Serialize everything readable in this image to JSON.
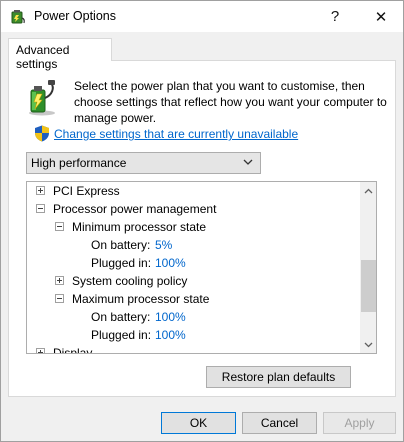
{
  "window": {
    "title": "Power Options",
    "help_label": "?",
    "close_label": "✕"
  },
  "tab": {
    "label": "Advanced settings"
  },
  "intro": {
    "text": "Select the power plan that you want to customise, then choose settings that reflect how you want your computer to manage power.",
    "link": "Change settings that are currently unavailable"
  },
  "plan_select": {
    "value": "High performance"
  },
  "tree": {
    "pci_express": "PCI Express",
    "processor_power_management": "Processor power management",
    "minimum_processor_state": "Minimum processor state",
    "min_on_battery_label": "On battery:",
    "min_on_battery_value": "5%",
    "min_plugged_in_label": "Plugged in:",
    "min_plugged_in_value": "100%",
    "system_cooling_policy": "System cooling policy",
    "maximum_processor_state": "Maximum processor state",
    "max_on_battery_label": "On battery:",
    "max_on_battery_value": "100%",
    "max_plugged_in_label": "Plugged in:",
    "max_plugged_in_value": "100%",
    "display": "Display"
  },
  "buttons": {
    "restore": "Restore plan defaults",
    "ok": "OK",
    "cancel": "Cancel",
    "apply": "Apply"
  },
  "colors": {
    "link": "#0066cc",
    "value": "#0066cc",
    "accent_border": "#0078d7"
  },
  "icons": {
    "title": "power-options-icon",
    "intro": "battery-plug-icon",
    "shield": "uac-shield-icon"
  }
}
